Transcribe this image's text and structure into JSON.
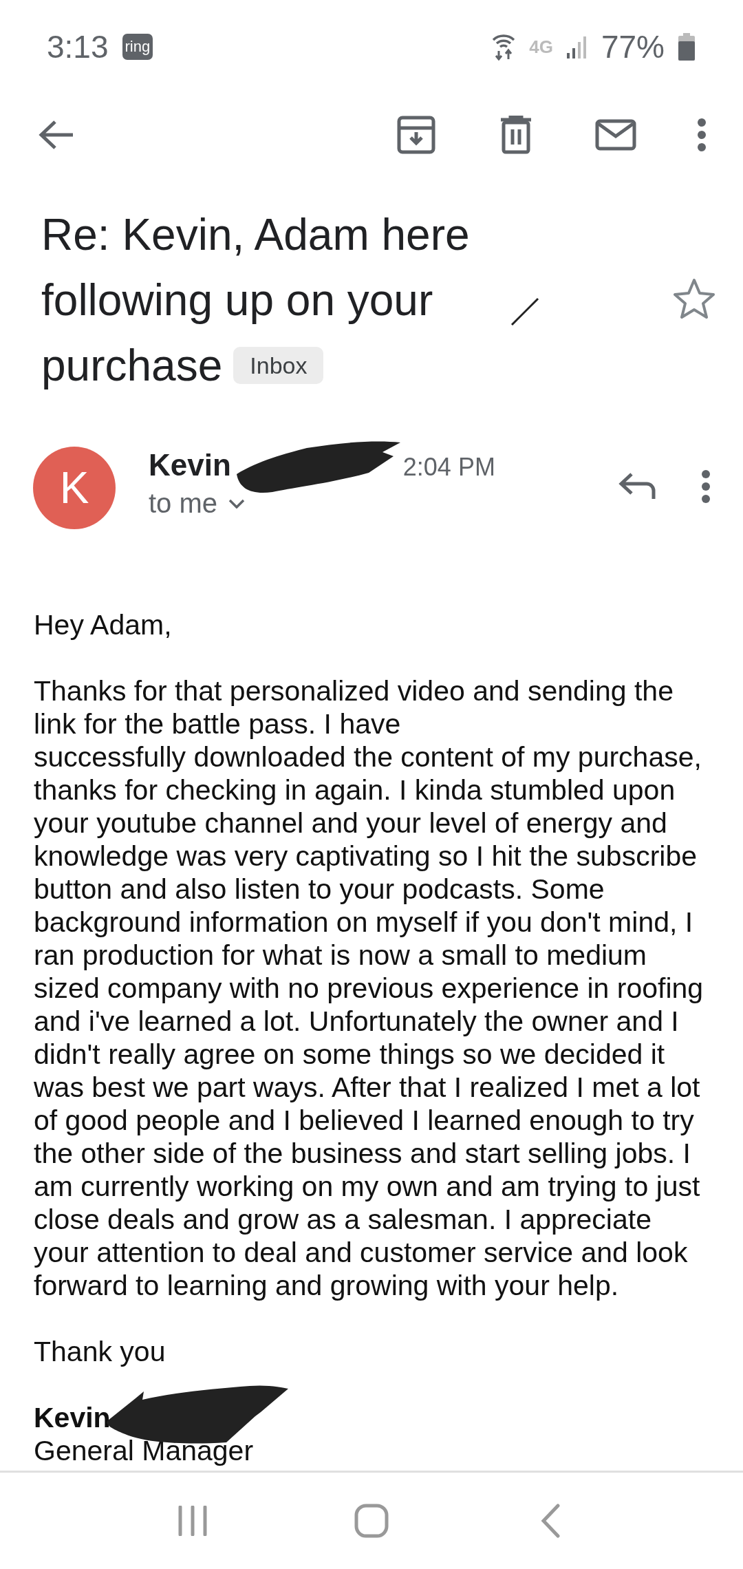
{
  "status_bar": {
    "time": "3:13",
    "notification_app": "ring",
    "battery": "77%",
    "network": "4G"
  },
  "toolbar": {
    "actions": [
      {
        "kind": "archive"
      },
      {
        "kind": "delete"
      },
      {
        "kind": "unread"
      },
      {
        "kind": "more"
      }
    ]
  },
  "subject": {
    "lines": [
      "Re: Kevin, Adam here",
      "following up on your",
      "purchase"
    ],
    "label": "Inbox",
    "starred": false
  },
  "message": {
    "avatar_letter": "K",
    "sender": "Kevin",
    "time": "2:04 PM",
    "recipient": "to me"
  },
  "body": {
    "paragraphs": [
      "Hey Adam,",
      "Thanks for that personalized video and sending the\nlink for the battle pass. I have\nsuccessfully downloaded the content of my purchase,\nthanks for checking in again. I kinda stumbled upon\nyour youtube channel and your level of energy and\nknowledge was very captivating so I hit the subscribe\nbutton and also listen to your podcasts. Some\nbackground information on myself if you don't mind, I\nran production for what is now a small to medium\nsized company with no previous experience in roofing\nand i've learned a lot. Unfortunately the owner and I\ndidn't really agree on some things so we decided it\nwas best we part ways. After that I realized I met a lot\nof good people and I believed I learned enough to try\nthe other side of the business and start selling jobs. I\nam currently working on my own and am trying to just\nclose deals and grow as a salesman. I appreciate\nyour attention to deal and customer service and look\nforward to learning and growing with your help.",
      "Thank you"
    ],
    "signature": {
      "name": "Kevin",
      "title": "General Manager"
    }
  }
}
